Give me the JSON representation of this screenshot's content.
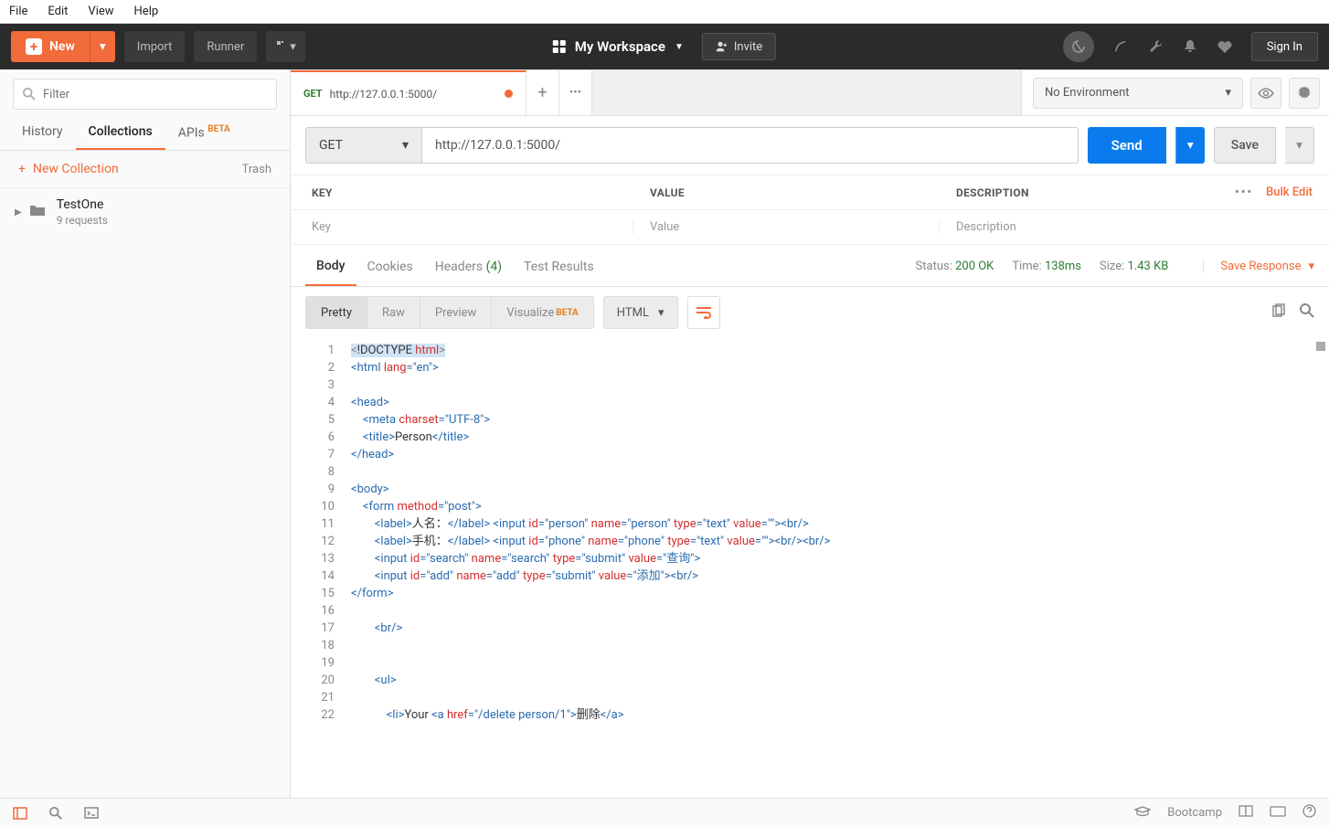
{
  "menubar": [
    "File",
    "Edit",
    "View",
    "Help"
  ],
  "topbar": {
    "new": "New",
    "import": "Import",
    "runner": "Runner",
    "workspace": "My Workspace",
    "invite": "Invite",
    "signin": "Sign In"
  },
  "sidebar": {
    "filter_placeholder": "Filter",
    "tabs": {
      "history": "History",
      "collections": "Collections",
      "apis": "APIs",
      "beta": "BETA"
    },
    "new_collection": "New Collection",
    "trash": "Trash",
    "collection": {
      "name": "TestOne",
      "sub": "9 requests"
    }
  },
  "request": {
    "tab_method": "GET",
    "tab_url": "http://127.0.0.1:5000/",
    "method": "GET",
    "url": "http://127.0.0.1:5000/",
    "send": "Send",
    "save": "Save",
    "env": "No Environment"
  },
  "params": {
    "h_key": "KEY",
    "h_val": "VALUE",
    "h_desc": "DESCRIPTION",
    "bulk": "Bulk Edit",
    "ph_key": "Key",
    "ph_val": "Value",
    "ph_desc": "Description"
  },
  "response": {
    "tabs": {
      "body": "Body",
      "cookies": "Cookies",
      "headers": "Headers",
      "hcount": "(4)",
      "tests": "Test Results"
    },
    "status_l": "Status:",
    "status_v": "200 OK",
    "time_l": "Time:",
    "time_v": "138ms",
    "size_l": "Size:",
    "size_v": "1.43 KB",
    "save": "Save Response"
  },
  "viewbar": {
    "pretty": "Pretty",
    "raw": "Raw",
    "preview": "Preview",
    "visualize": "Visualize",
    "beta": "BETA",
    "format": "HTML"
  },
  "status": {
    "bootcamp": "Bootcamp"
  }
}
